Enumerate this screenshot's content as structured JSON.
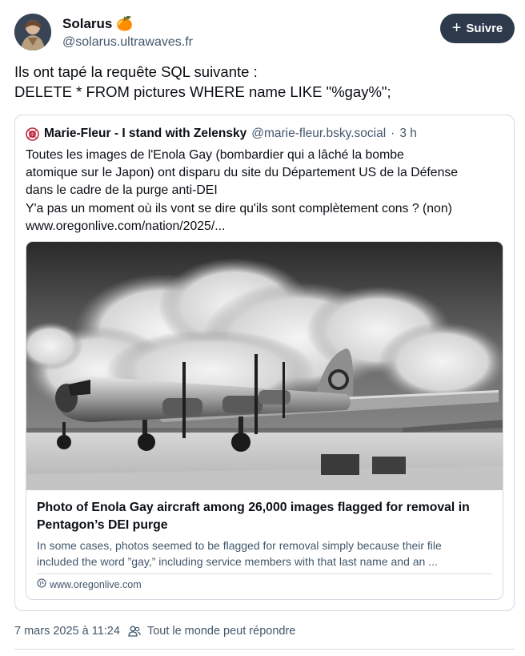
{
  "author": {
    "display_name": "Solarus",
    "emoji": "🍊",
    "handle": "@solarus.ultrawaves.fr"
  },
  "follow_button": {
    "icon": "plus-icon",
    "label": "Suivre"
  },
  "post_text": [
    "Ils ont tapé la requête SQL suivante :",
    "DELETE * FROM pictures WHERE name LIKE \"%gay%\";"
  ],
  "quote": {
    "author_name": "Marie-Fleur - I stand with Zelensky",
    "handle": "@marie-fleur.bsky.social",
    "separator": "·",
    "time": "3 h",
    "text_lines": [
      "Toutes les images de l'Enola Gay (bombardier qui a lâché la bombe",
      "atomique sur le Japon) ont disparu du site du Département US de la Défense",
      "dans le cadre de la purge anti-DEI",
      "Y'a pas un moment où ils vont se dire qu'ils sont complètement cons ? (non)",
      "www.oregonlive.com/nation/2025/..."
    ],
    "link_card": {
      "title": "Photo of Enola Gay aircraft among 26,000 images flagged for removal in Pentagon’s DEI purge",
      "description_lines": [
        "In some cases, photos seemed to be flagged for removal simply because their file",
        "included the word ”gay,” including service members with that last name and an ..."
      ],
      "domain": "www.oregonlive.com",
      "domain_icon": "globe-icon",
      "image_icon": "airplane-photo"
    }
  },
  "meta": {
    "timestamp": "7 mars 2025 à 11:24",
    "reply_icon": "people-icon",
    "reply_setting": "Tout le monde peut répondre"
  },
  "colors": {
    "text": "#0b0f14",
    "secondary_text": "#42576c",
    "border": "#d4dbe2",
    "follow_button_bg": "#2c3a4c"
  }
}
